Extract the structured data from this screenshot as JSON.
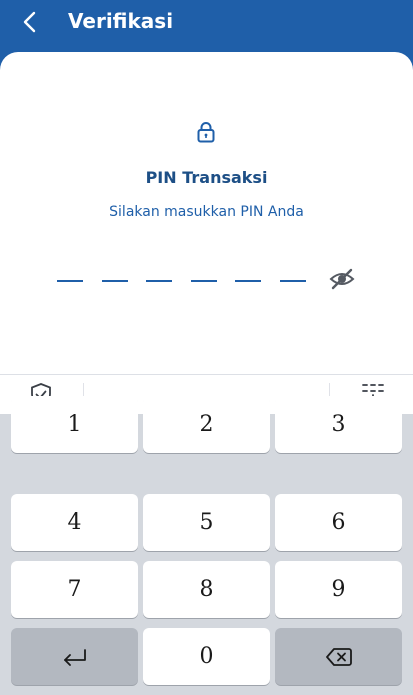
{
  "header": {
    "title": "Verifikasi",
    "back_icon": "chevron-left-icon"
  },
  "pin": {
    "icon": "lock-icon",
    "title": "PIN Transaksi",
    "subtitle": "Silakan masukkan PIN Anda",
    "length": 6,
    "visibility_icon": "eye-slash-icon"
  },
  "keyboard_toolbar": {
    "left_icon": "shield-check-icon",
    "right_icon": "keyboard-hide-icon"
  },
  "keypad": {
    "keys": [
      "1",
      "2",
      "3",
      "4",
      "5",
      "6",
      "7",
      "8",
      "9",
      "0"
    ],
    "enter_icon": "enter-icon",
    "backspace_icon": "backspace-icon"
  },
  "colors": {
    "brand": "#1f5fa9",
    "title_text": "#1d4f86",
    "keypad_bg": "#d4d8de",
    "key_bg": "#ffffff",
    "key_dark_bg": "#b3b8c0"
  }
}
